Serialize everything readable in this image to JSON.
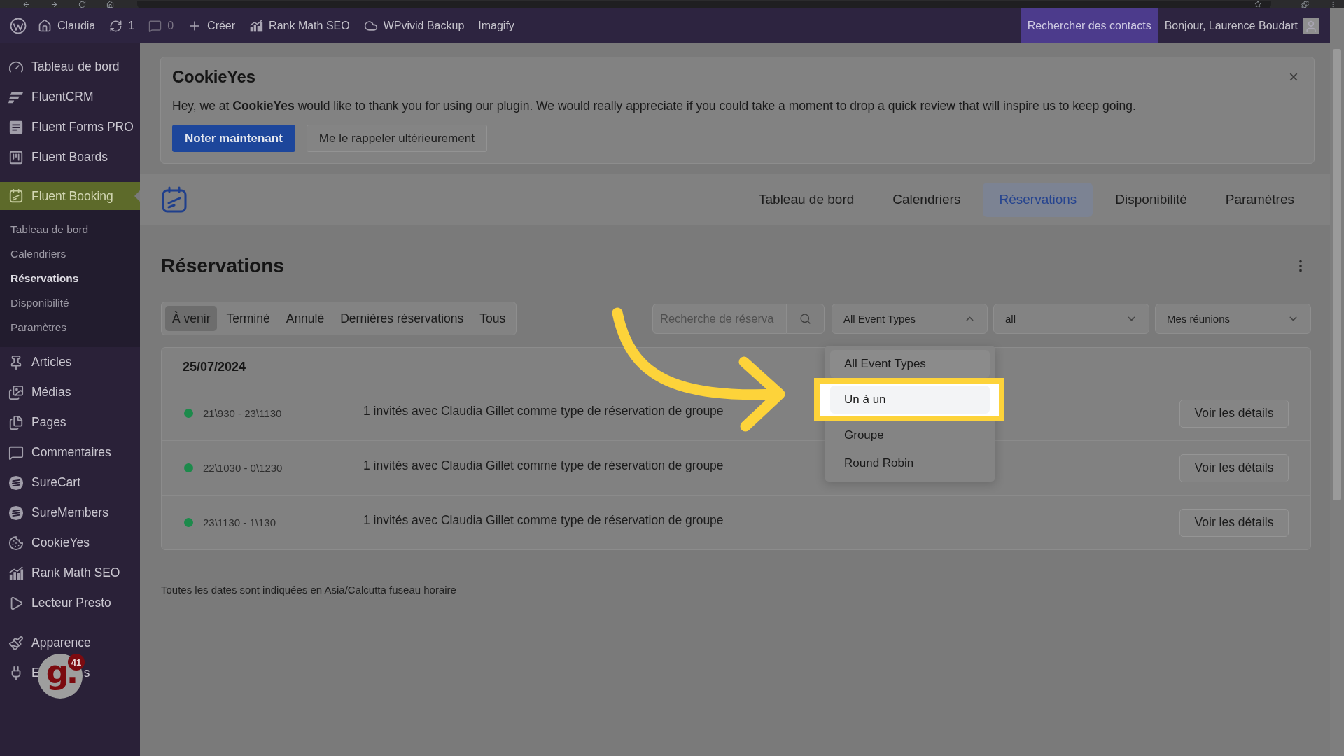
{
  "admin_bar": {
    "items": [
      {
        "label": "Claudia",
        "disabled": false
      },
      {
        "label": "1",
        "disabled": false
      },
      {
        "label": "0",
        "disabled": true
      },
      {
        "label": "Créer",
        "disabled": false
      },
      {
        "label": "Rank Math SEO",
        "disabled": false
      },
      {
        "label": "WPvivid Backup",
        "disabled": false
      },
      {
        "label": "Imagify",
        "disabled": false
      }
    ],
    "contacts_search": "Rechercher des contacts",
    "greeting": "Bonjour, Laurence Boudart"
  },
  "sidebar": {
    "sections": [
      {
        "items": [
          {
            "label": "Tableau de bord",
            "selected": false
          },
          {
            "label": "FluentCRM",
            "selected": false
          },
          {
            "label": "Fluent Forms PRO",
            "selected": false
          },
          {
            "label": "Fluent Boards",
            "selected": false
          }
        ]
      },
      {
        "items": [
          {
            "label": "Fluent Booking",
            "selected": true,
            "children": [
              {
                "label": "Tableau de bord",
                "selected": false
              },
              {
                "label": "Calendriers",
                "selected": false
              },
              {
                "label": "Réservations",
                "selected": true
              },
              {
                "label": "Disponibilité",
                "selected": false
              },
              {
                "label": "Paramètres",
                "selected": false
              }
            ]
          },
          {
            "label": "Articles",
            "selected": false
          },
          {
            "label": "Médias",
            "selected": false
          },
          {
            "label": "Pages",
            "selected": false
          },
          {
            "label": "Commentaires",
            "selected": false
          },
          {
            "label": "SureCart",
            "selected": false
          },
          {
            "label": "SureMembers",
            "selected": false
          },
          {
            "label": "CookieYes",
            "selected": false
          },
          {
            "label": "Rank Math SEO",
            "selected": false
          },
          {
            "label": "Lecteur Presto",
            "selected": false
          }
        ]
      },
      {
        "items": [
          {
            "label": "Apparence",
            "selected": false
          },
          {
            "label": "E",
            "label_end": "s",
            "selected": false
          }
        ]
      }
    ]
  },
  "extension_widget": {
    "logo": "g.",
    "badge": "41"
  },
  "notice": {
    "logo": "CookieYes",
    "close": "×",
    "message": "Hey, we at **CookieYes** would like to thank you for using our plugin. We would really appreciate if you could take a moment to drop a quick review that will inspire us to keep going.",
    "buttons": [
      {
        "label": "Noter maintenant",
        "kind": "primary"
      },
      {
        "label": "Me le rappeler ultérieurement",
        "kind": "secondary"
      }
    ]
  },
  "app_nav": {
    "tabs": [
      {
        "label": "Tableau de bord",
        "selected": false
      },
      {
        "label": "Calendriers",
        "selected": false
      },
      {
        "label": "Réservations",
        "selected": true
      },
      {
        "label": "Disponibilité",
        "selected": false
      },
      {
        "label": "Paramètres",
        "selected": false
      }
    ]
  },
  "page": {
    "title": "Réservations"
  },
  "filters": {
    "tabs": [
      {
        "label": "À venir",
        "selected": true
      },
      {
        "label": "Terminé",
        "selected": false
      },
      {
        "label": "Annulé",
        "selected": false
      },
      {
        "label": "Dernières réservations",
        "selected": false
      },
      {
        "label": "Tous",
        "selected": false
      }
    ],
    "search": {
      "placeholder": "Recherche de réserva"
    },
    "selects": [
      {
        "value": "All Event Types",
        "expanded": true,
        "options": [
          {
            "label": "All Event Types",
            "selected": true,
            "highlighted": false
          },
          {
            "label": "Un à un",
            "selected": false,
            "highlighted": true
          },
          {
            "label": "Groupe",
            "selected": false,
            "highlighted": false
          },
          {
            "label": "Round Robin",
            "selected": false,
            "highlighted": false
          }
        ]
      },
      {
        "value": "all",
        "expanded": false
      },
      {
        "value": "Mes réunions",
        "expanded": false
      }
    ]
  },
  "bookings": {
    "groups": [
      {
        "date": "25/07/2024",
        "rows": [
          {
            "time": "21\\930 - 23\\1130",
            "description": "1 invités avec Claudia Gillet comme type de réservation de groupe",
            "action": "Voir les détails"
          },
          {
            "time": "22\\1030 - 0\\1230",
            "description": "1 invités avec Claudia Gillet comme type de réservation de groupe",
            "action": "Voir les détails"
          },
          {
            "time": "23\\1130 - 1\\130",
            "description": "1 invités avec Claudia Gillet comme type de réservation de groupe",
            "action": "Voir les détails"
          }
        ]
      }
    ]
  },
  "footer_note": "Toutes les dates sont indiquées en Asia/Calcutta fuseau horaire"
}
